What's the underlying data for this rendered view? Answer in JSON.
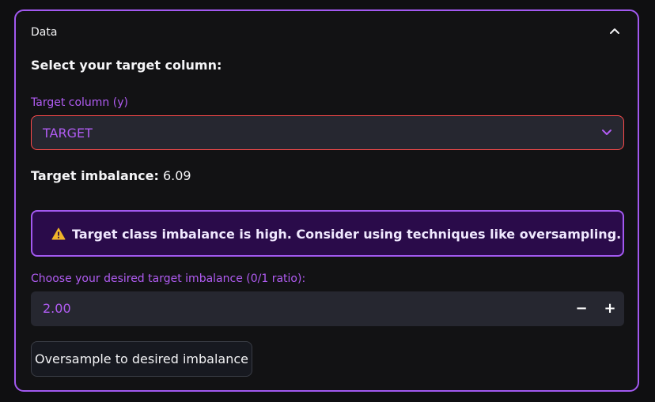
{
  "expander": {
    "title": "Data",
    "expanded": true,
    "toggle_icon": "chevron-up-icon"
  },
  "section": {
    "heading": "Select your target column:"
  },
  "target_select": {
    "label": "Target column (y)",
    "value": "TARGET",
    "dropdown_icon": "chevron-down-icon"
  },
  "imbalance": {
    "label": "Target imbalance:",
    "value": "6.09"
  },
  "warning": {
    "icon": "warning-icon",
    "text": "Target class imbalance is high. Consider using techniques like oversampling."
  },
  "ratio_input": {
    "label": "Choose your desired target imbalance (0/1 ratio):",
    "value": "2.00",
    "decrement_label": "−",
    "increment_label": "+"
  },
  "action": {
    "label": "Oversample to desired imbalance"
  },
  "colors": {
    "accent": "#a259f0",
    "label_purple": "#b15cf3",
    "select_border": "#ff4b4b",
    "warning_bg": "#2a0b4a",
    "warning_icon": "#f0b429",
    "input_bg": "#262730",
    "page_bg": "#0f0f11"
  }
}
